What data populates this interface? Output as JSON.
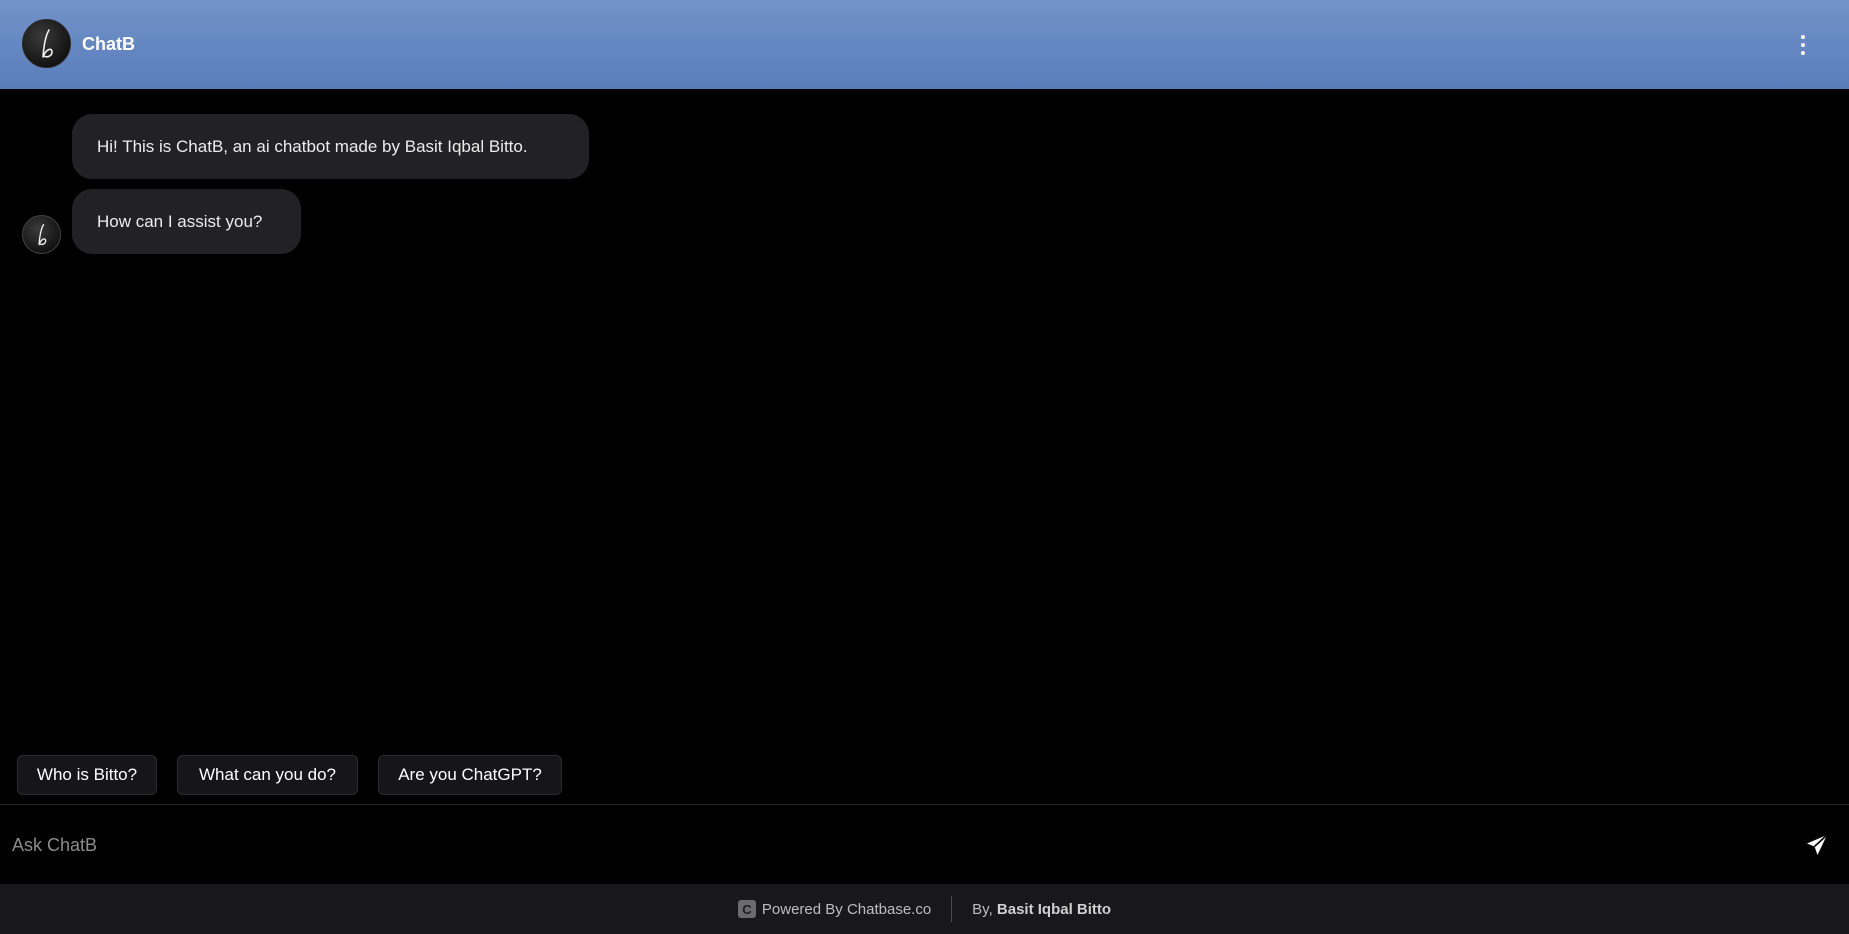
{
  "header": {
    "title": "ChatB",
    "avatar_icon": "signature-b-icon",
    "menu_icon": "kebab-menu-icon"
  },
  "messages": [
    {
      "role": "bot",
      "text": "Hi! This is ChatB, an ai chatbot made by Basit Iqbal Bitto."
    },
    {
      "role": "bot",
      "text": "How can I assist you?"
    }
  ],
  "suggestions": [
    {
      "label": "Who is Bitto?"
    },
    {
      "label": "What can you do?"
    },
    {
      "label": "Are you ChatGPT?"
    }
  ],
  "input": {
    "placeholder": "Ask ChatB",
    "value": ""
  },
  "footer": {
    "powered_by": "Powered By Chatbase.co",
    "logo_letter": "C",
    "by_prefix": "By,",
    "author": "Basit Iqbal Bitto"
  },
  "colors": {
    "header_gradient_top": "#7293c8",
    "header_gradient_bottom": "#5a7cba",
    "background": "#000000",
    "bubble": "#222224",
    "footer": "#18181a"
  }
}
